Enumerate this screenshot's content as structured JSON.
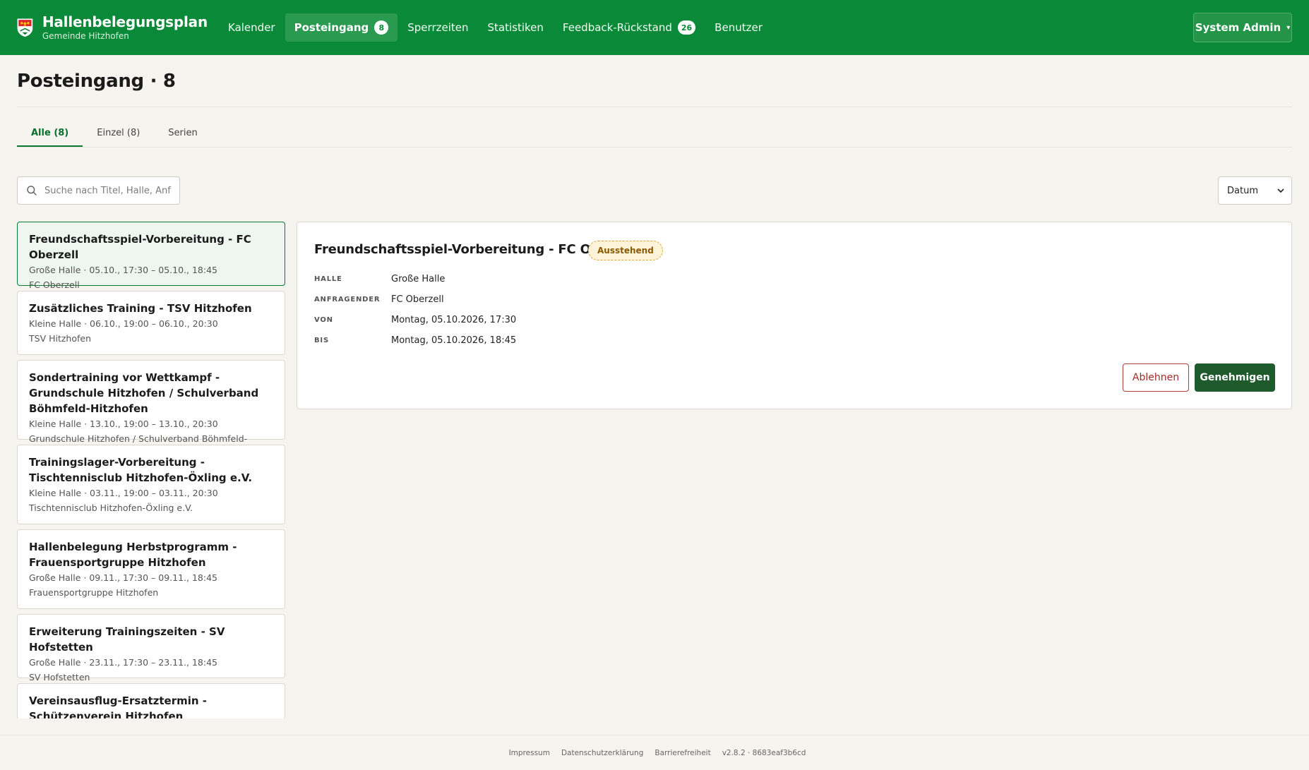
{
  "app": {
    "title": "Hallenbelegungsplan",
    "subtitle": "Gemeinde Hitzhofen"
  },
  "nav": {
    "items": [
      {
        "label": "Kalender"
      },
      {
        "label": "Posteingang",
        "badge": "8",
        "active": true
      },
      {
        "label": "Sperrzeiten"
      },
      {
        "label": "Statistiken"
      },
      {
        "label": "Feedback-Rückstand",
        "badge": "26"
      },
      {
        "label": "Benutzer"
      }
    ],
    "user_label": "System Admin",
    "user_caret": "▾"
  },
  "page": {
    "title": "Posteingang · 8"
  },
  "tabs": [
    {
      "label": "Alle (8)",
      "active": true
    },
    {
      "label": "Einzel (8)"
    },
    {
      "label": "Serien"
    }
  ],
  "search": {
    "placeholder": "Suche nach Titel, Halle, Anfragender",
    "value": ""
  },
  "sort": {
    "selected": "Datum"
  },
  "requests": [
    {
      "title": "Freundschaftsspiel-Vorbereitung - FC Oberzell",
      "meta": "Große Halle · 05.10., 17:30 – 05.10., 18:45",
      "org": "FC Oberzell",
      "selected": true
    },
    {
      "title": "Zusätzliches Training - TSV Hitzhofen",
      "meta": "Kleine Halle · 06.10., 19:00 – 06.10., 20:30",
      "org": "TSV Hitzhofen"
    },
    {
      "title": "Sondertraining vor Wettkampf - Grundschule Hitzhofen / Schulverband Böhmfeld-Hitzhofen",
      "meta": "Kleine Halle · 13.10., 19:00 – 13.10., 20:30",
      "org": "Grundschule Hitzhofen / Schulverband Böhmfeld-Hitzhofen"
    },
    {
      "title": "Trainingslager-Vorbereitung - Tischtennisclub Hitzhofen-Öxling e.V.",
      "meta": "Kleine Halle · 03.11., 19:00 – 03.11., 20:30",
      "org": "Tischtennisclub Hitzhofen-Öxling e.V."
    },
    {
      "title": "Hallenbelegung Herbstprogramm - Frauensportgruppe Hitzhofen",
      "meta": "Große Halle · 09.11., 17:30 – 09.11., 18:45",
      "org": "Frauensportgruppe Hitzhofen"
    },
    {
      "title": "Erweiterung Trainingszeiten - SV Hofstetten",
      "meta": "Große Halle · 23.11., 17:30 – 23.11., 18:45",
      "org": "SV Hofstetten"
    },
    {
      "title": "Vereinsausflug-Ersatztermin - Schützenverein Hitzhofen",
      "meta": "",
      "org": ""
    }
  ],
  "detail": {
    "title": "Freundschaftsspiel-Vorbereitung - FC Oberzell",
    "status": "Ausstehend",
    "fields": [
      {
        "label": "Halle",
        "value": "Große Halle"
      },
      {
        "label": "Anfragender",
        "value": "FC Oberzell"
      },
      {
        "label": "Von",
        "value": "Montag, 05.10.2026, 17:30"
      },
      {
        "label": "Bis",
        "value": "Montag, 05.10.2026, 18:45"
      }
    ],
    "reject_label": "Ablehnen",
    "approve_label": "Genehmigen"
  },
  "footer": {
    "links": [
      "Impressum",
      "Datenschutzerklärung",
      "Barrierefreiheit"
    ],
    "version": "v2.8.2 · 8683eaf3b6cd"
  },
  "colors": {
    "header": "#0a8a38",
    "accent": "#0a7a33",
    "approve": "#1e5a2c",
    "reject": "#a52a2a",
    "status_pending_bg": "#fdf3d8"
  }
}
